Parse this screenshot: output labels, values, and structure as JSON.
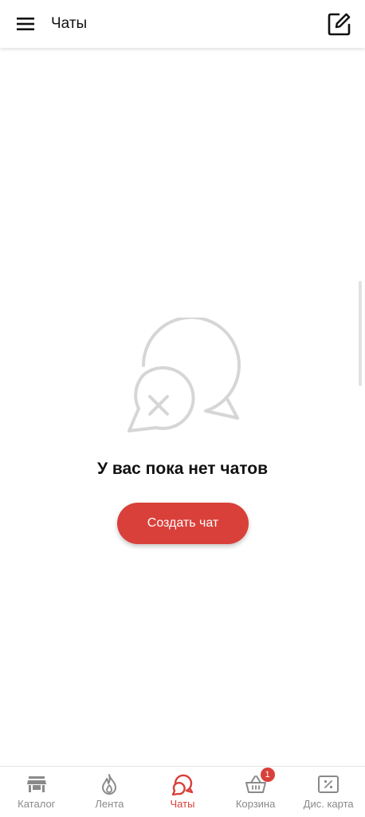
{
  "header": {
    "title": "Чаты"
  },
  "empty_state": {
    "title": "У вас пока нет чатов",
    "create_button_label": "Создать чат"
  },
  "bottom_nav": {
    "items": [
      {
        "label": "Каталог",
        "icon": "store-icon",
        "active": false
      },
      {
        "label": "Лента",
        "icon": "flame-icon",
        "active": false
      },
      {
        "label": "Чаты",
        "icon": "chat-bubbles-icon",
        "active": true
      },
      {
        "label": "Корзина",
        "icon": "basket-icon",
        "active": false,
        "badge": "1"
      },
      {
        "label": "Дис. карта",
        "icon": "discount-card-icon",
        "active": false
      }
    ]
  },
  "colors": {
    "accent": "#d9403a",
    "inactive": "#8a8a8a",
    "text": "#111111",
    "empty_icon": "#d6d6d6"
  }
}
